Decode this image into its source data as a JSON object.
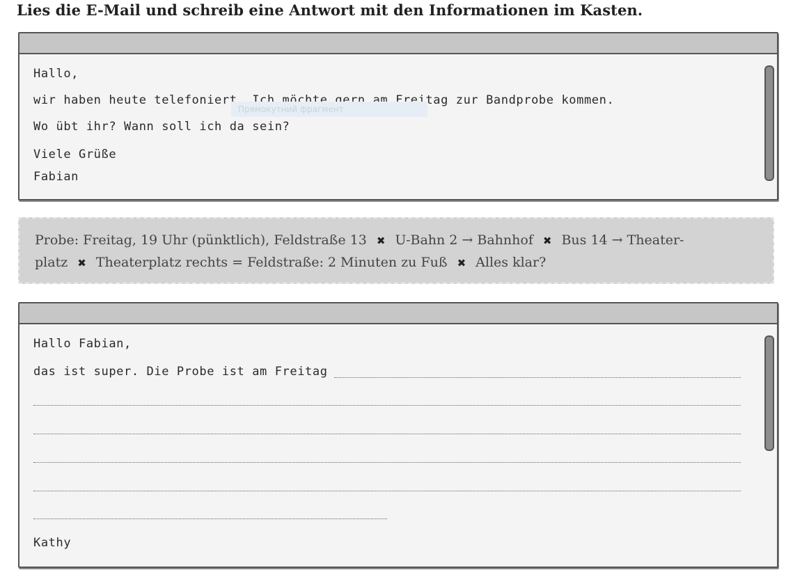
{
  "instruction": "Lies die E-Mail und schreib eine Antwort mit den Informationen im Kasten.",
  "email": {
    "lines": [
      "Hallo,",
      "wir haben heute telefoniert. Ich möchte gern am Freitag zur Bandprobe kommen.",
      "Wo übt ihr? Wann soll ich da sein?",
      "Viele Grüße",
      "Fabian"
    ]
  },
  "overlay": {
    "text": "Прямокутний фрагмент"
  },
  "info_box": {
    "items": [
      "Probe: Freitag, 19 Uhr (pünktlich), Feldstraße 13",
      "U-Bahn 2 → Bahnhof",
      "Bus 14 → Theater-",
      "platz",
      "Theaterplatz rechts = Feldstraße: 2 Minuten zu Fuß",
      "Alles klar?"
    ],
    "separator": "✖"
  },
  "reply": {
    "greeting": "Hallo Fabian,",
    "start": "das ist super. Die Probe ist am Freitag",
    "signature": "Kathy"
  }
}
